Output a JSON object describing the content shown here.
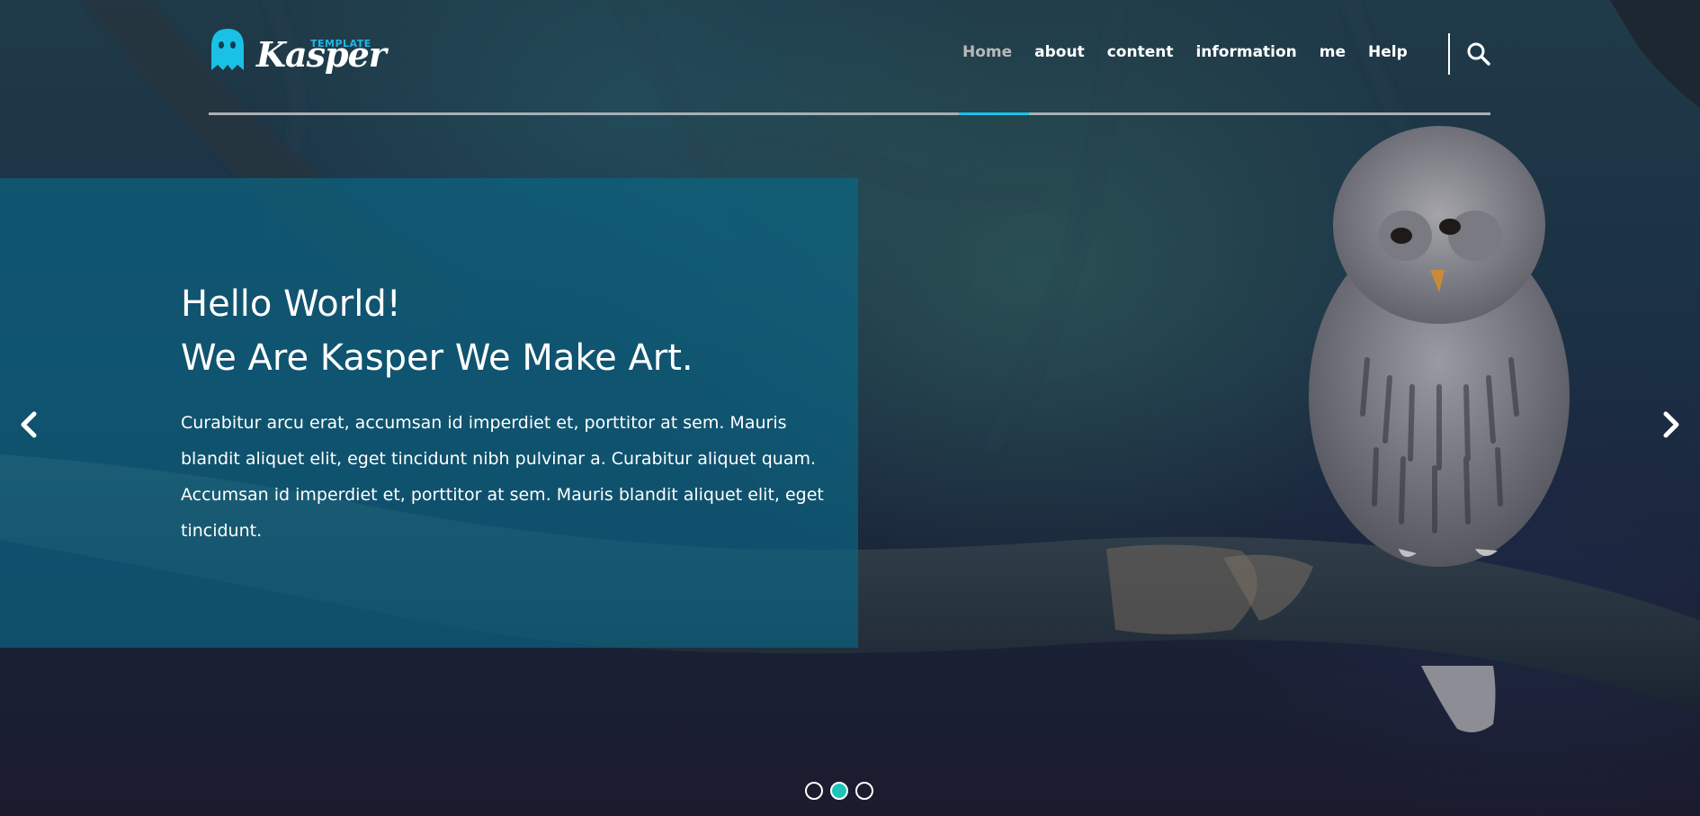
{
  "brand": {
    "name": "Kasper",
    "tagline": "TEMPLATE",
    "accent_color": "#19c1e6",
    "logo_icon": "ghost-icon"
  },
  "nav": {
    "items": [
      {
        "label": "Home",
        "active": true
      },
      {
        "label": "about",
        "active": false
      },
      {
        "label": "content",
        "active": false
      },
      {
        "label": "information",
        "active": false
      },
      {
        "label": "me",
        "active": false
      },
      {
        "label": "Help",
        "active": false
      }
    ],
    "search_icon": "search-icon"
  },
  "hero": {
    "headline_line1": "Hello World!",
    "headline_line2": "We Are Kasper We Make Art.",
    "body": "Curabitur arcu erat, accumsan id imperdiet et, porttitor at sem. Mauris blandit aliquet elit, eget tincidunt nibh pulvinar a. Curabitur aliquet quam. Accumsan id imperdiet et, porttitor at sem. Mauris blandit aliquet elit, eget tincidunt.",
    "background_image": "owl-on-branch-photo",
    "panel_color": "#0b6684"
  },
  "slider": {
    "prev_icon": "chevron-left-icon",
    "next_icon": "chevron-right-icon",
    "dots_count": 3,
    "active_dot": 2,
    "active_dot_color": "#1fc4b9"
  }
}
